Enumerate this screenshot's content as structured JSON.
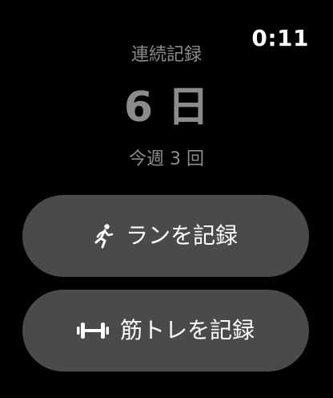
{
  "status": {
    "time": "0:11"
  },
  "streak": {
    "label": "連続記録",
    "value": "6 日"
  },
  "week": {
    "summary": "今週 3 回"
  },
  "actions": [
    {
      "label": "ランを記録",
      "icon": "running-figure-icon"
    },
    {
      "label": "筋トレを記録",
      "icon": "dumbbell-icon"
    }
  ],
  "colors": {
    "background": "#000000",
    "button": "#4a4a4a",
    "muted_text": "#8c8c8c",
    "text": "#ffffff"
  }
}
